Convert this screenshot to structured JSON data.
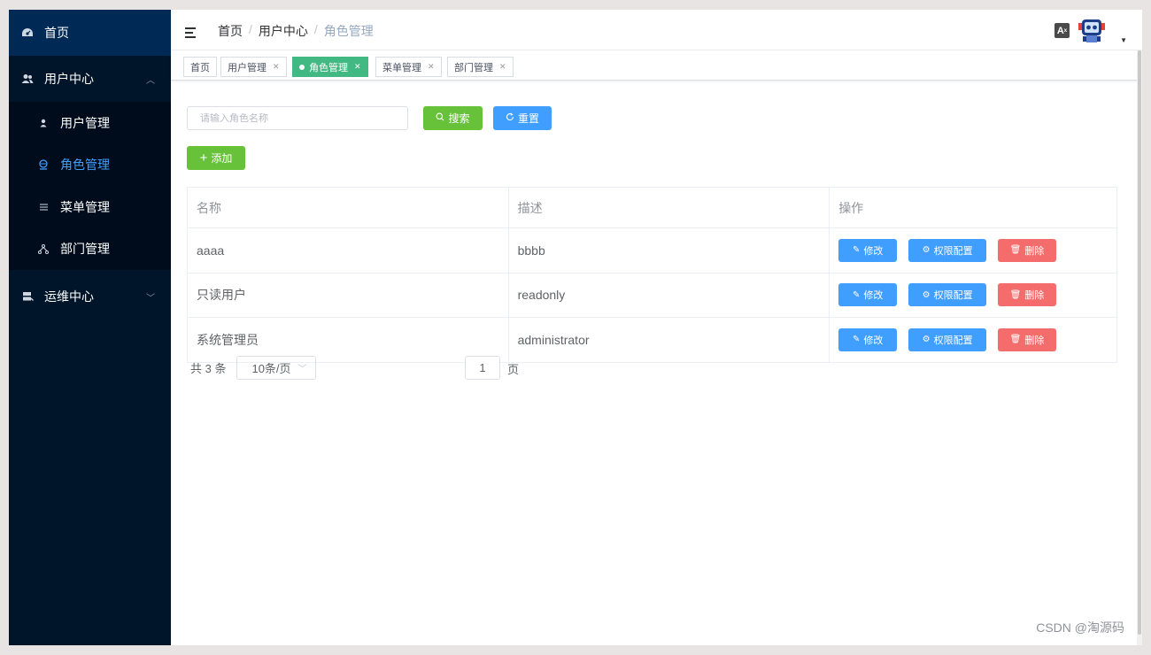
{
  "sidebar": {
    "home": "首页",
    "user_center": "用户中心",
    "sub_items": [
      "用户管理",
      "角色管理",
      "菜单管理",
      "部门管理"
    ],
    "ops_center": "运维中心"
  },
  "header": {
    "breadcrumb": [
      "首页",
      "用户中心",
      "角色管理"
    ],
    "lang_label": "A"
  },
  "tags": [
    {
      "label": "首页"
    },
    {
      "label": "用户管理"
    },
    {
      "label": "角色管理"
    },
    {
      "label": "菜单管理"
    },
    {
      "label": "部门管理"
    }
  ],
  "search": {
    "placeholder": "请输入角色名称",
    "search_label": "搜索",
    "reset_label": "重置"
  },
  "add_label": "添加",
  "table": {
    "headers": [
      "名称",
      "描述",
      "操作"
    ],
    "rows": [
      {
        "name": "aaaa",
        "desc": "bbbb"
      },
      {
        "name": "只读用户",
        "desc": "readonly"
      },
      {
        "name": "系统管理员",
        "desc": "administrator"
      }
    ],
    "actions": {
      "edit": "修改",
      "perm": "权限配置",
      "delete": "删除"
    }
  },
  "pagination": {
    "total": "共 3 条",
    "page_size": "10条/页",
    "page": "1",
    "page_suffix": "页"
  },
  "watermark": "CSDN @淘源码",
  "colors": {
    "sidebar_bg": "#001529",
    "primary": "#409eff",
    "success": "#67c23a",
    "danger": "#f56c6c",
    "active_tag": "#42b983"
  }
}
